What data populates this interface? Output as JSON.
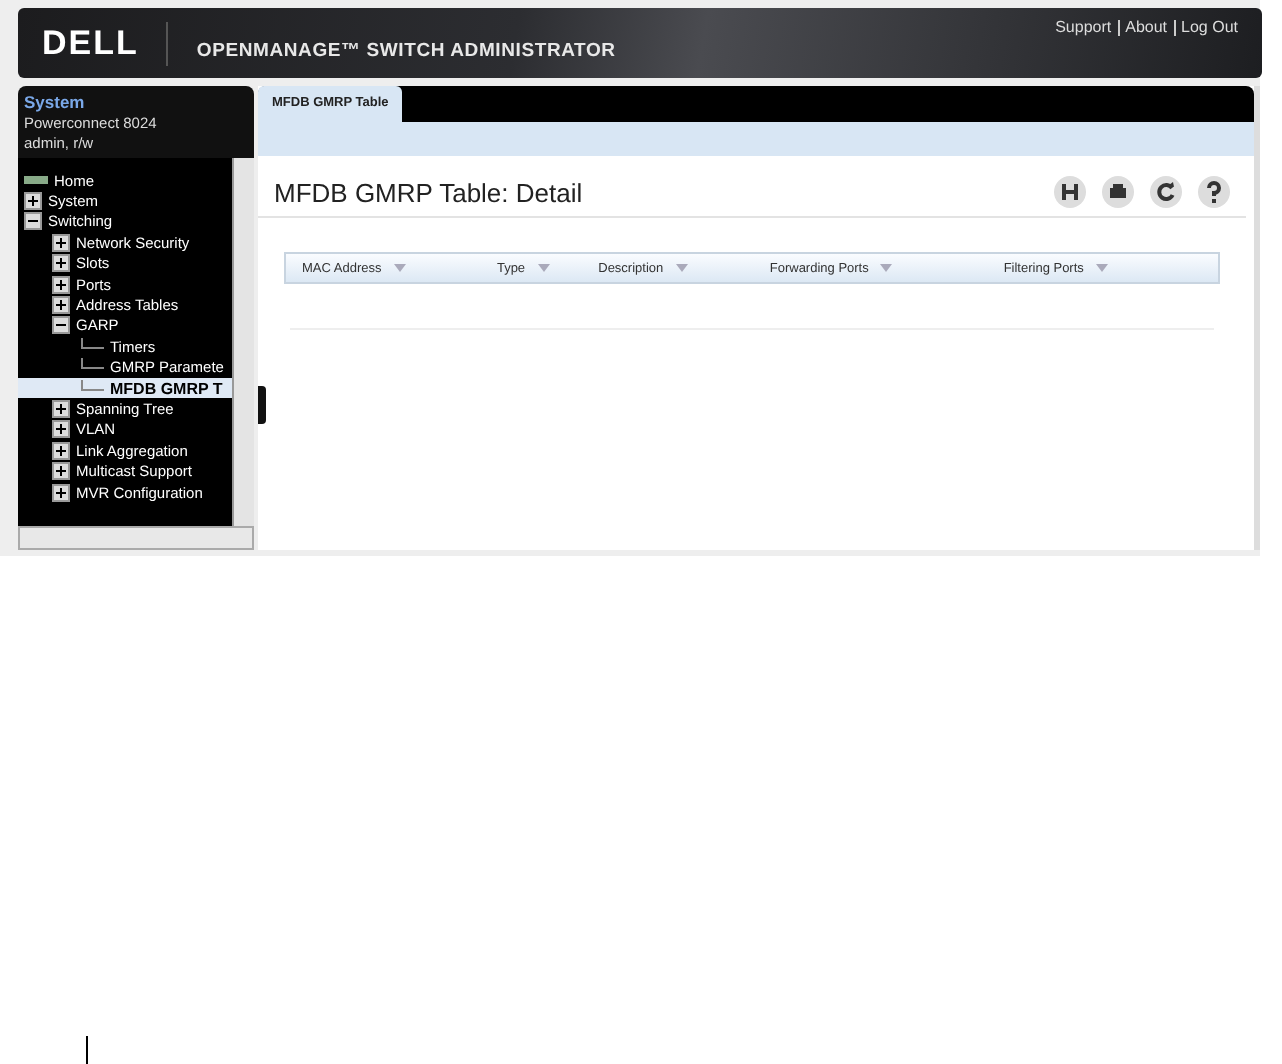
{
  "header": {
    "brand": "DELL",
    "product": "OPENMANAGE™ SWITCH ADMINISTRATOR",
    "links": [
      "Support",
      "About",
      "Log Out"
    ]
  },
  "sidebar": {
    "title": "System",
    "device": "Powerconnect 8024",
    "user": "admin, r/w",
    "tree": [
      {
        "label": "Home",
        "kind": "home",
        "selected": false
      },
      {
        "label": "System",
        "kind": "folder",
        "expanded": false,
        "selected": false
      },
      {
        "label": "Switching",
        "kind": "folder",
        "expanded": true,
        "selected": false,
        "children": [
          {
            "label": "Network Security",
            "kind": "folder",
            "expanded": false,
            "selected": false
          },
          {
            "label": "Slots",
            "kind": "folder",
            "expanded": false,
            "selected": false
          },
          {
            "label": "Ports",
            "kind": "folder",
            "expanded": false,
            "selected": false
          },
          {
            "label": "Address Tables",
            "kind": "folder",
            "expanded": false,
            "selected": false
          },
          {
            "label": "GARP",
            "kind": "folder",
            "expanded": true,
            "selected": false,
            "children": [
              {
                "label": "Timers",
                "kind": "page",
                "selected": false
              },
              {
                "label": "GMRP Paramete",
                "kind": "page",
                "selected": false
              },
              {
                "label": "MFDB GMRP T",
                "kind": "page",
                "selected": true
              }
            ]
          },
          {
            "label": "Spanning Tree",
            "kind": "folder",
            "expanded": false,
            "selected": false
          },
          {
            "label": "VLAN",
            "kind": "folder",
            "expanded": false,
            "selected": false
          },
          {
            "label": "Link Aggregation",
            "kind": "folder",
            "expanded": false,
            "selected": false
          },
          {
            "label": "Multicast Support",
            "kind": "folder",
            "expanded": false,
            "selected": false
          },
          {
            "label": "MVR Configuration",
            "kind": "folder",
            "expanded": false,
            "selected": false
          }
        ]
      }
    ]
  },
  "tabs": [
    {
      "label": "MFDB GMRP Table",
      "selected": true
    }
  ],
  "page": {
    "title": "MFDB GMRP Table: Detail"
  },
  "table": {
    "columns": [
      "MAC Address",
      "Type",
      "Description",
      "Forwarding Ports",
      "Filtering Ports"
    ]
  }
}
